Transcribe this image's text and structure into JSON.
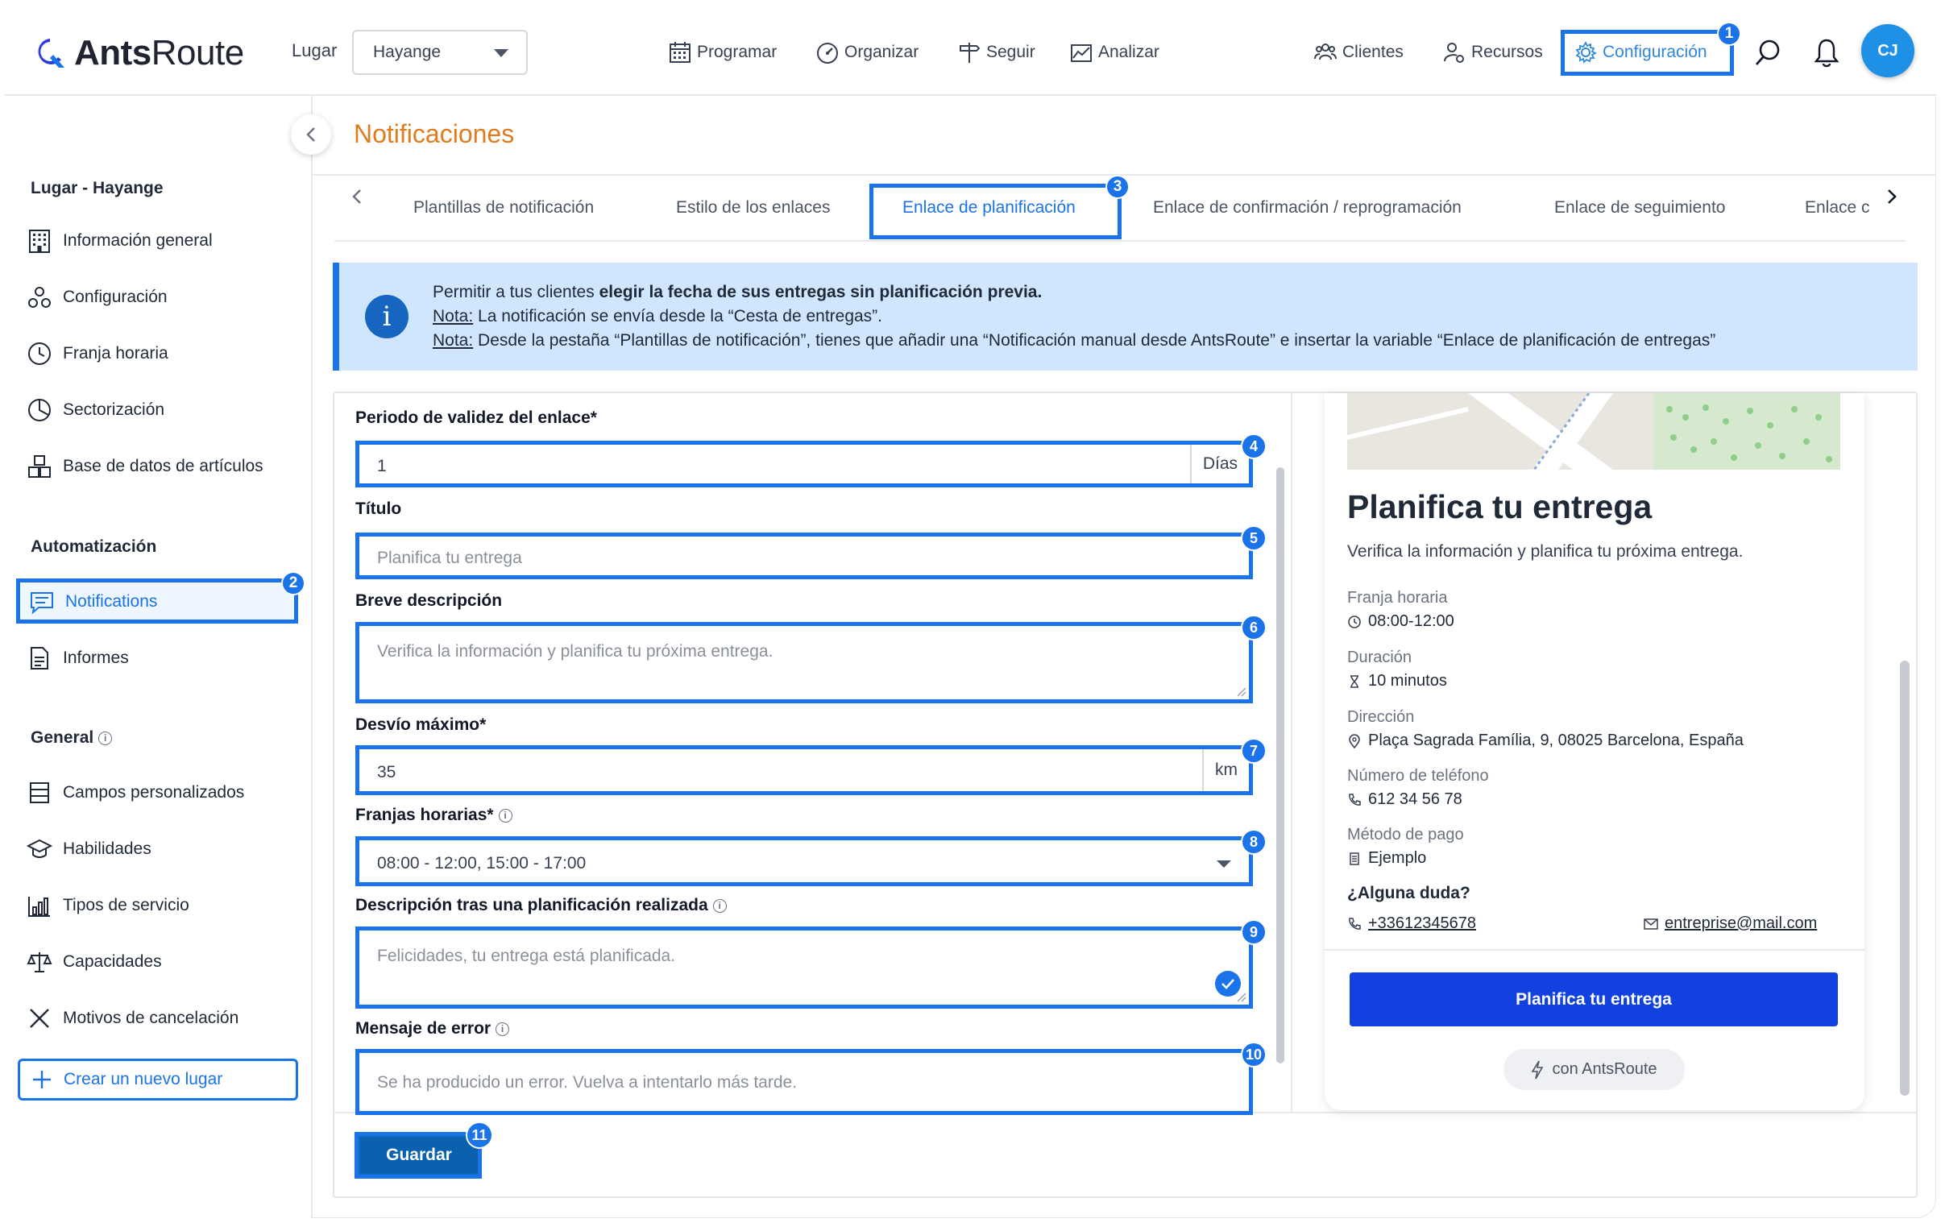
{
  "app": {
    "logo_main": "Ants",
    "logo_rest": "Route",
    "lugar_label": "Lugar",
    "lugar_value": "Hayange"
  },
  "nav": {
    "programar": "Programar",
    "organizar": "Organizar",
    "seguir": "Seguir",
    "analizar": "Analizar",
    "clientes": "Clientes",
    "recursos": "Recursos",
    "configuracion": "Configuración",
    "avatar_initials": "CJ"
  },
  "badges": [
    "1",
    "2",
    "3",
    "4",
    "5",
    "6",
    "7",
    "8",
    "9",
    "10",
    "11"
  ],
  "sidebar": {
    "section1": "Lugar - Hayange",
    "items1": [
      "Información general",
      "Configuración",
      "Franja horaria",
      "Sectorización",
      "Base de datos de artículos"
    ],
    "section2": "Automatización",
    "notifications": "Notifications",
    "informes": "Informes",
    "section3": "General",
    "items3": [
      "Campos personalizados",
      "Habilidades",
      "Tipos de servicio",
      "Capacidades",
      "Motivos de cancelación"
    ],
    "create": "Crear un nuevo lugar"
  },
  "page": {
    "title": "Notificaciones"
  },
  "tabs": [
    "Plantillas de notificación",
    "Estilo de los enlaces",
    "Enlace de planificación",
    "Enlace de confirmación / reprogramación",
    "Enlace de seguimiento",
    "Enlace c"
  ],
  "info": {
    "line1_a": "Permitir a tus clientes ",
    "line1_b": "elegir la fecha de sus entregas sin planificación previa.",
    "nota": "Nota:",
    "line2": " La notificación se envía desde la “Cesta de entregas”.",
    "line3": " Desde la pestaña “Plantillas de notificación”, tienes que añadir una “Notificación manual desde AntsRoute” e insertar la variable “Enlace de planificación de entregas”"
  },
  "form": {
    "validez_label": "Periodo de validez del enlace*",
    "validez_value": "1",
    "validez_suffix": "Días",
    "titulo_label": "Título",
    "titulo_placeholder": "Planifica tu entrega",
    "desc_label": "Breve descripción",
    "desc_placeholder": "Verifica la información y planifica tu próxima entrega.",
    "desvio_label": "Desvío máximo*",
    "desvio_value": "35",
    "desvio_suffix": "km",
    "franjas_label": "Franjas horarias*",
    "franjas_value": "08:00 - 12:00, 15:00 - 17:00",
    "tras_label": "Descripción tras una planificación realizada",
    "tras_placeholder": "Felicidades, tu entrega está planificada.",
    "error_label": "Mensaje de error",
    "error_placeholder": "Se ha producido un error. Vuelva a intentarlo más tarde.",
    "save": "Guardar"
  },
  "preview": {
    "title": "Planifica tu entrega",
    "subtitle": "Verifica la información y planifica tu próxima entrega.",
    "franja_label": "Franja horaria",
    "franja_value": "08:00-12:00",
    "duracion_label": "Duración",
    "duracion_value": "10 minutos",
    "direccion_label": "Dirección",
    "direccion_value": "Plaça Sagrada Família, 9, 08025 Barcelona, España",
    "telefono_label": "Número de teléfono",
    "telefono_value": "612 34 56 78",
    "pago_label": "Método de pago",
    "pago_value": "Ejemplo",
    "duda": "¿Alguna duda?",
    "phone_link": "+33612345678",
    "email_link": "entreprise@mail.com",
    "button": "Planifica tu entrega",
    "powered": "con AntsRoute"
  },
  "colors": {
    "accent": "#1a73e8",
    "title_orange": "#e07b1e",
    "info_bg": "#cfe6fc",
    "preview_button": "#1142e0"
  }
}
